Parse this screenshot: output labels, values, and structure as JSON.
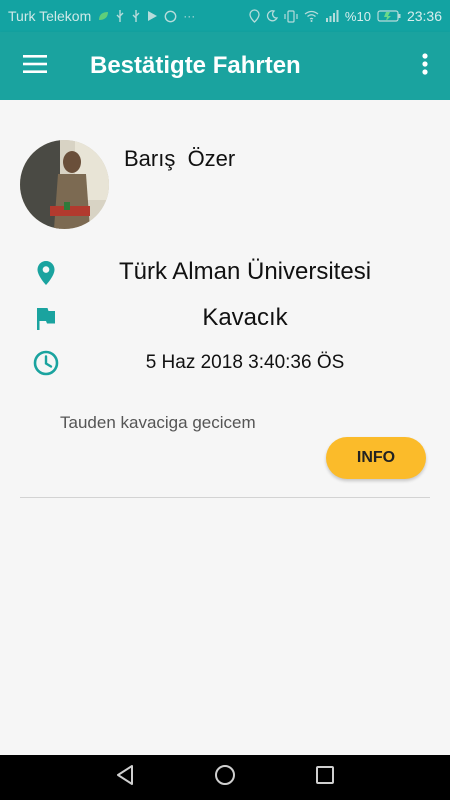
{
  "status_bar": {
    "carrier": "Turk Telekom",
    "battery": "%10",
    "time": "23:36",
    "icons_left": [
      "leaf-icon",
      "usb-icon",
      "usb-icon",
      "play-icon",
      "whatsapp-icon",
      "more-icon"
    ],
    "icons_right": [
      "location-icon",
      "moon-icon",
      "vibrate-icon",
      "wifi-icon",
      "signal-icon",
      "battery-icon"
    ]
  },
  "app_bar": {
    "title": "Bestätigte Fahrten",
    "menu_icon": "hamburger-menu-icon",
    "overflow_icon": "more-vert-icon",
    "color": "#1aa39f"
  },
  "ride": {
    "name": "Barış  Özer",
    "destination": "Türk Alman Üniversitesi",
    "location": "Kavacık",
    "datetime": "5 Haz 2018 3:40:36 ÖS",
    "comment": "Tauden kavaciga gecicem",
    "info_label": "INFO",
    "icon_color": "#1aa39f",
    "button_color": "#fbbb2a"
  }
}
